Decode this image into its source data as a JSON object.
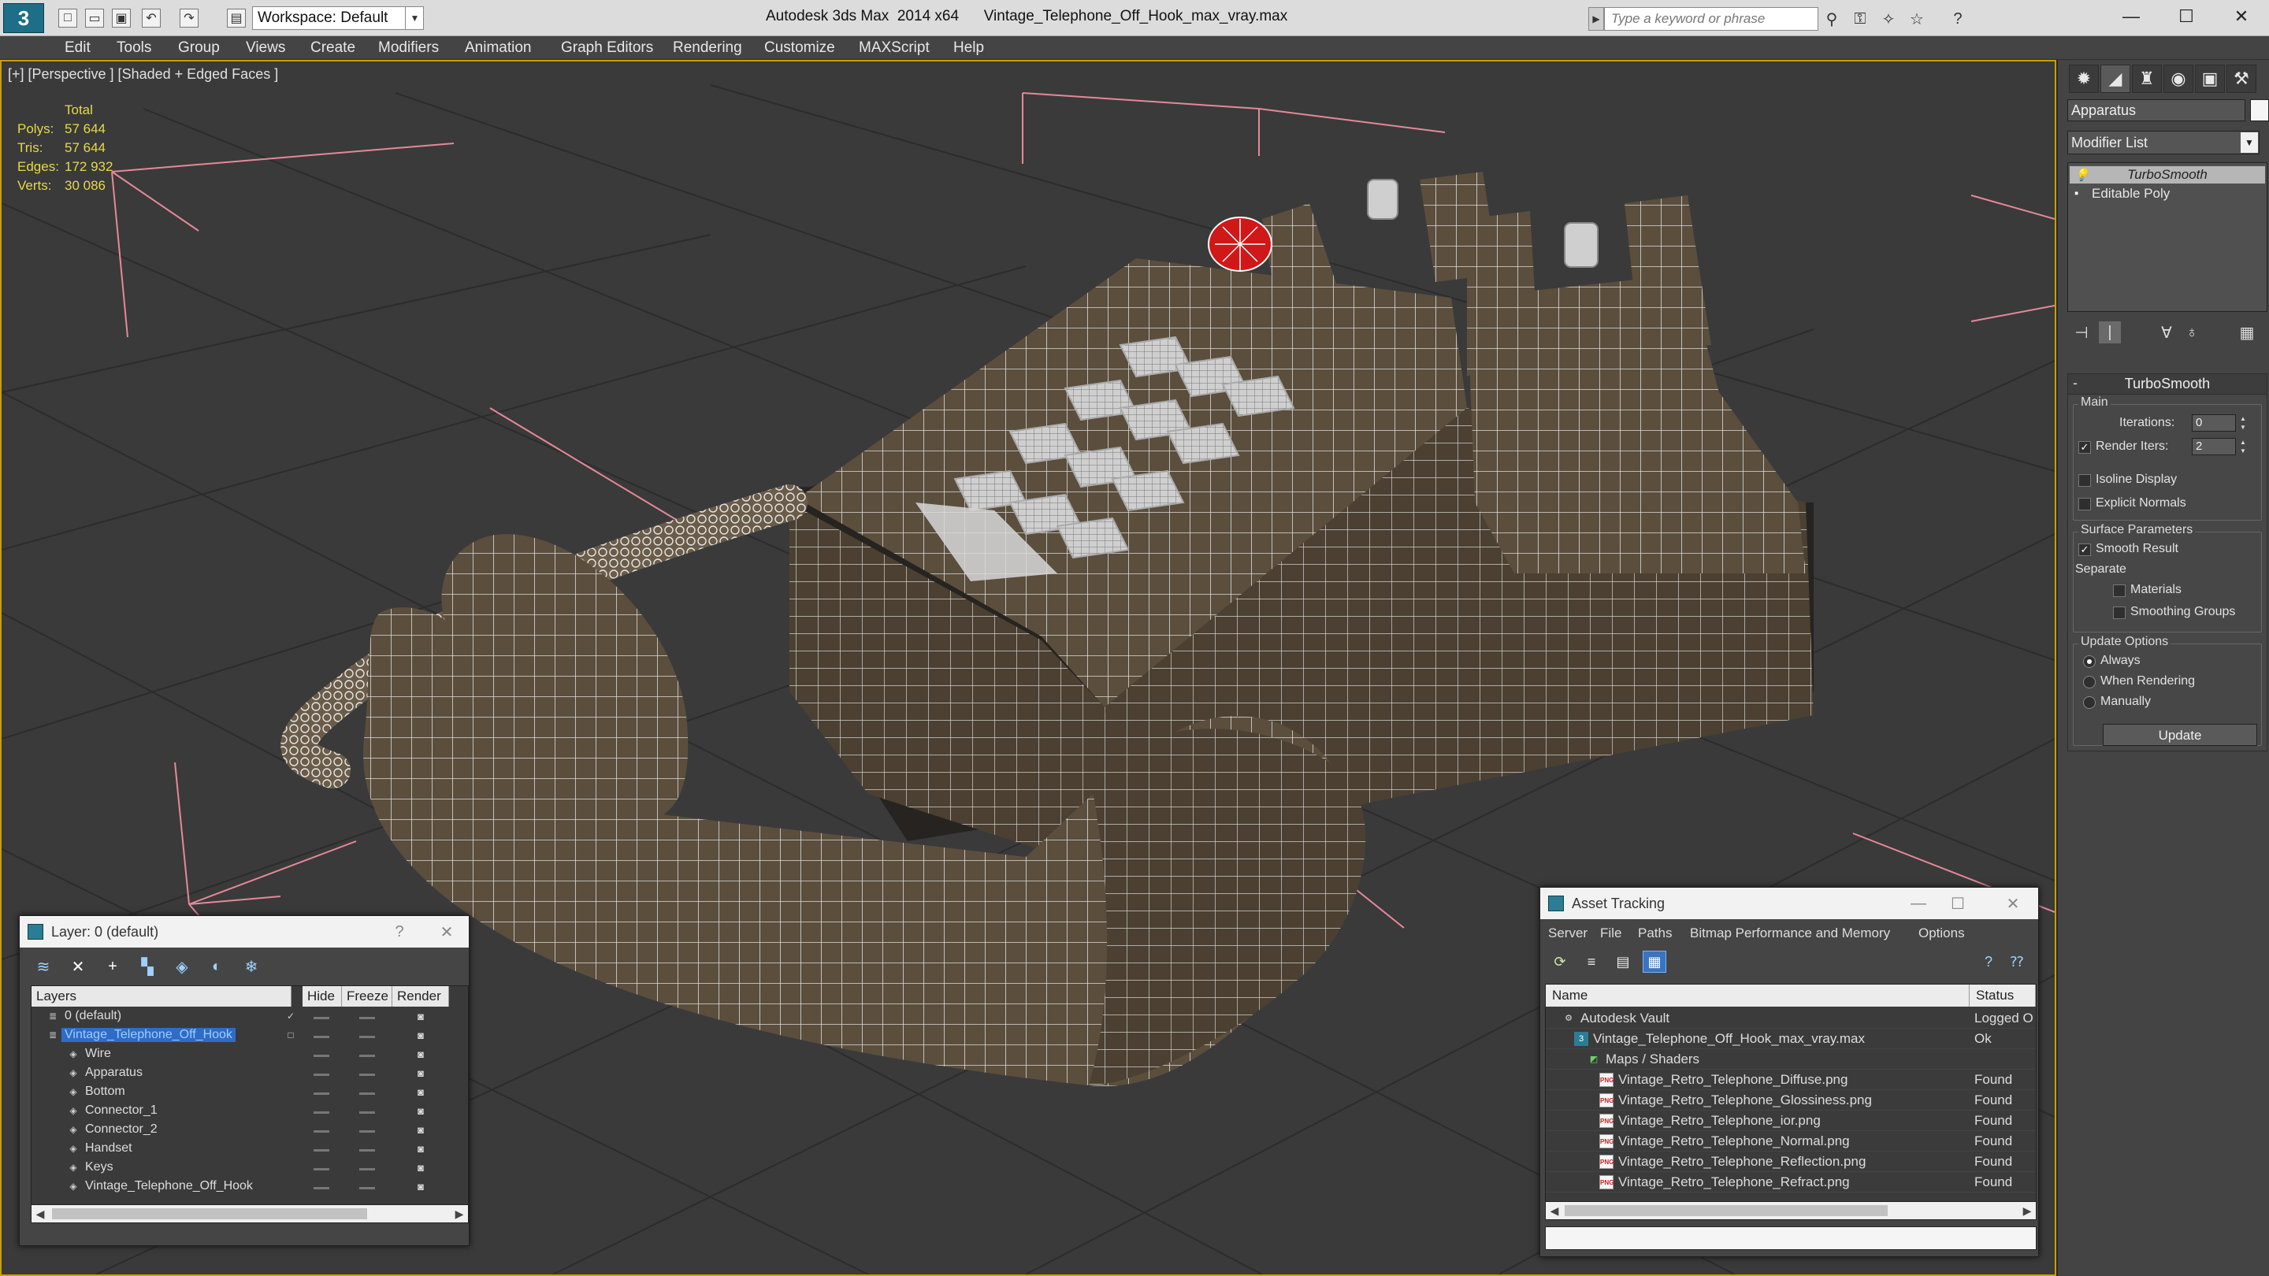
{
  "app": {
    "window_title": "Autodesk 3ds Max  2014 x64      Vintage_Telephone_Off_Hook_max_vray.max",
    "workspace": "Workspace: Default",
    "search_placeholder": "Type a keyword or phrase",
    "logo": "3"
  },
  "menu": [
    "Edit",
    "Tools",
    "Group",
    "Views",
    "Create",
    "Modifiers",
    "Animation",
    "Graph Editors",
    "Rendering",
    "Customize",
    "MAXScript",
    "Help"
  ],
  "viewport": {
    "label": "[+] [Perspective ] [Shaded + Edged Faces ]",
    "stats": {
      "header": "Total",
      "rows": [
        {
          "label": "Polys:",
          "value": "57 644"
        },
        {
          "label": "Tris:",
          "value": "57 644"
        },
        {
          "label": "Edges:",
          "value": "172 932"
        },
        {
          "label": "Verts:",
          "value": "30 086"
        }
      ]
    }
  },
  "command_panel": {
    "object_name": "Apparatus",
    "modifier_list": "Modifier List",
    "stack": [
      {
        "label": "TurboSmooth",
        "selected": true
      },
      {
        "label": "Editable Poly",
        "selected": false
      }
    ],
    "rollout_title": "TurboSmooth",
    "main_group": "Main",
    "iterations_label": "Iterations:",
    "iterations_value": "0",
    "render_iters_label": "Render Iters:",
    "render_iters_value": "2",
    "isoline_label": "Isoline Display",
    "explicit_normals_label": "Explicit Normals",
    "surface_group": "Surface Parameters",
    "smooth_result_label": "Smooth Result",
    "separate_label": "Separate",
    "materials_label": "Materials",
    "smoothing_groups_label": "Smoothing Groups",
    "update_group": "Update Options",
    "always_label": "Always",
    "when_rendering_label": "When Rendering",
    "manually_label": "Manually",
    "update_button": "Update"
  },
  "layer_dialog": {
    "title": "Layer: 0 (default)",
    "help": "?",
    "columns": [
      "Layers",
      "Hide",
      "Freeze",
      "Render"
    ],
    "rows": [
      {
        "name": "0 (default)",
        "indent": 1,
        "selected": false
      },
      {
        "name": "Vintage_Telephone_Off_Hook",
        "indent": 1,
        "selected": true
      },
      {
        "name": "Wire",
        "indent": 2,
        "selected": false
      },
      {
        "name": "Apparatus",
        "indent": 2,
        "selected": false
      },
      {
        "name": "Bottom",
        "indent": 2,
        "selected": false
      },
      {
        "name": "Connector_1",
        "indent": 2,
        "selected": false
      },
      {
        "name": "Connector_2",
        "indent": 2,
        "selected": false
      },
      {
        "name": "Handset",
        "indent": 2,
        "selected": false
      },
      {
        "name": "Keys",
        "indent": 2,
        "selected": false
      },
      {
        "name": "Vintage_Telephone_Off_Hook",
        "indent": 2,
        "selected": false
      }
    ]
  },
  "asset_dialog": {
    "title": "Asset Tracking",
    "menu": [
      "Server",
      "File",
      "Paths",
      "Bitmap Performance and Memory",
      "Options"
    ],
    "columns": [
      "Name",
      "Status"
    ],
    "rows": [
      {
        "name": "Autodesk Vault",
        "status": "Logged O",
        "indent": 0,
        "icon": "vault"
      },
      {
        "name": "Vintage_Telephone_Off_Hook_max_vray.max",
        "status": "Ok",
        "indent": 1,
        "icon": "max"
      },
      {
        "name": "Maps / Shaders",
        "status": "",
        "indent": 2,
        "icon": "maps"
      },
      {
        "name": "Vintage_Retro_Telephone_Diffuse.png",
        "status": "Found",
        "indent": 3,
        "icon": "png"
      },
      {
        "name": "Vintage_Retro_Telephone_Glossiness.png",
        "status": "Found",
        "indent": 3,
        "icon": "png"
      },
      {
        "name": "Vintage_Retro_Telephone_ior.png",
        "status": "Found",
        "indent": 3,
        "icon": "png"
      },
      {
        "name": "Vintage_Retro_Telephone_Normal.png",
        "status": "Found",
        "indent": 3,
        "icon": "png"
      },
      {
        "name": "Vintage_Retro_Telephone_Reflection.png",
        "status": "Found",
        "indent": 3,
        "icon": "png"
      },
      {
        "name": "Vintage_Retro_Telephone_Refract.png",
        "status": "Found",
        "indent": 3,
        "icon": "png"
      }
    ]
  },
  "colors": {
    "selection": "#2f6cc8",
    "stats": "#e6d84a",
    "viewport_bg": "#3a3a3a",
    "model": "#5a4d3c",
    "wire": "#e8e8e8"
  }
}
